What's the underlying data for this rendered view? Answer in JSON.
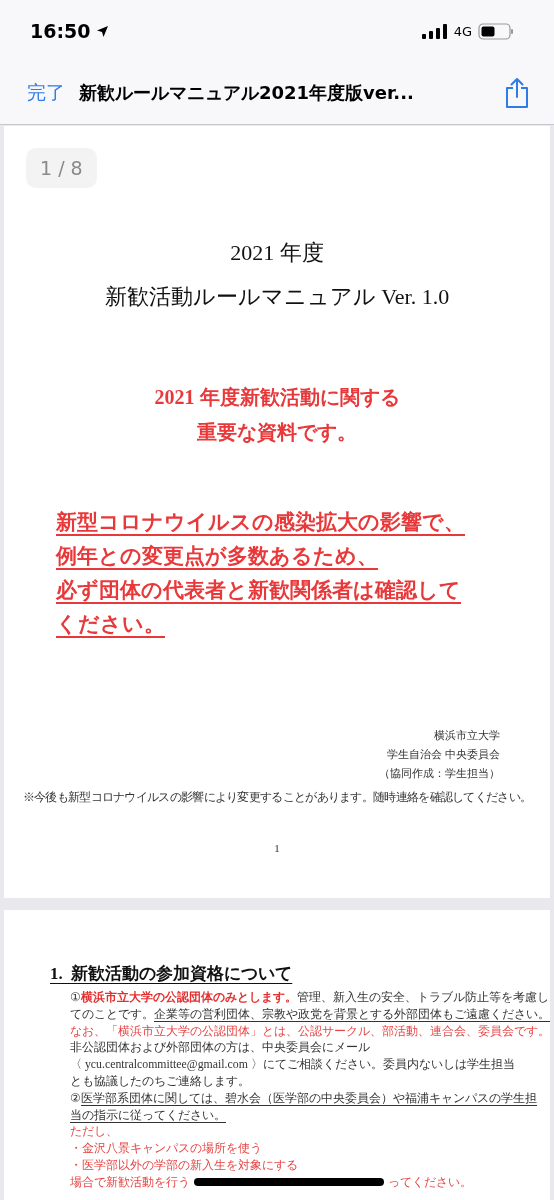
{
  "status_bar": {
    "time": "16:50",
    "network": "4G"
  },
  "nav": {
    "done": "完了",
    "title": "新歓ルールマニュアル2021年度版ver..."
  },
  "page_indicator": "1 / 8",
  "page1": {
    "title_lines": [
      "2021 年度",
      "新歓活動ルールマニュアル Ver. 1.0"
    ],
    "notice_lines": [
      "2021 年度新歓活動に関する",
      "重要な資料です。"
    ],
    "warning_lines": [
      "新型コロナウイルスの感染拡大の影響で、",
      "例年との変更点が多数あるため、",
      "必ず団体の代表者と新歓関係者は確認して",
      "ください。"
    ],
    "signature_lines": [
      "横浜市立大学",
      "学生自治会 中央委員会",
      "（協同作成：学生担当）"
    ],
    "note": "※今後も新型コロナウイルスの影響により変更することがあります。随時連絡を確認してください。",
    "page_number": "1"
  },
  "page2": {
    "heading": "1.  新歓活動の参加資格について",
    "lines": [
      {
        "segments": [
          {
            "text": "①",
            "kind": "plain"
          },
          {
            "text": "横浜市立大学の公認団体のみとします。",
            "kind": "emphasis"
          },
          {
            "text": "管理、新入生の安全、トラブル防止等を考慮し",
            "kind": "plain"
          }
        ]
      },
      {
        "segments": [
          {
            "text": "てのことです。",
            "kind": "plain"
          },
          {
            "text": "企業等の営利団体、宗教や政党を背景とする外部団体もご遠慮ください。",
            "kind": "underlined"
          }
        ]
      },
      {
        "segments": [
          {
            "text": "なお、「横浜市立大学の公認団体」とは、公認サークル、部活動、連合会、委員会です。",
            "kind": "alert"
          }
        ]
      },
      {
        "segments": [
          {
            "text": "非公認団体および外部団体の方は、中央委員会にメール",
            "kind": "plain"
          }
        ]
      },
      {
        "segments": [
          {
            "text": "〈 ycu.centralcommittee@gmail.com 〉にてご相談ください。委員内ないしは学生担当",
            "kind": "plain"
          }
        ]
      },
      {
        "segments": [
          {
            "text": "とも協議したのちご連絡します。",
            "kind": "plain"
          }
        ]
      },
      {
        "segments": [
          {
            "text": "②",
            "kind": "plain"
          },
          {
            "text": "医学部系団体に関しては、碧水会（医学部の中央委員会）や福浦キャンパスの学生担",
            "kind": "underlined"
          }
        ]
      },
      {
        "segments": [
          {
            "text": "当の指示に従ってください。",
            "kind": "underlined"
          }
        ]
      },
      {
        "segments": [
          {
            "text": "ただし、",
            "kind": "alert"
          }
        ]
      },
      {
        "segments": [
          {
            "text": "・金沢八景キャンパスの場所を使う",
            "kind": "alert"
          }
        ]
      },
      {
        "segments": [
          {
            "text": "・医学部以外の学部の新入生を対象にする",
            "kind": "alert"
          }
        ]
      },
      {
        "segments": [
          {
            "text": "場合で新歓活動を行う",
            "kind": "alert"
          },
          {
            "kind": "redacted"
          },
          {
            "text": "ってください。",
            "kind": "alert"
          }
        ]
      }
    ]
  }
}
